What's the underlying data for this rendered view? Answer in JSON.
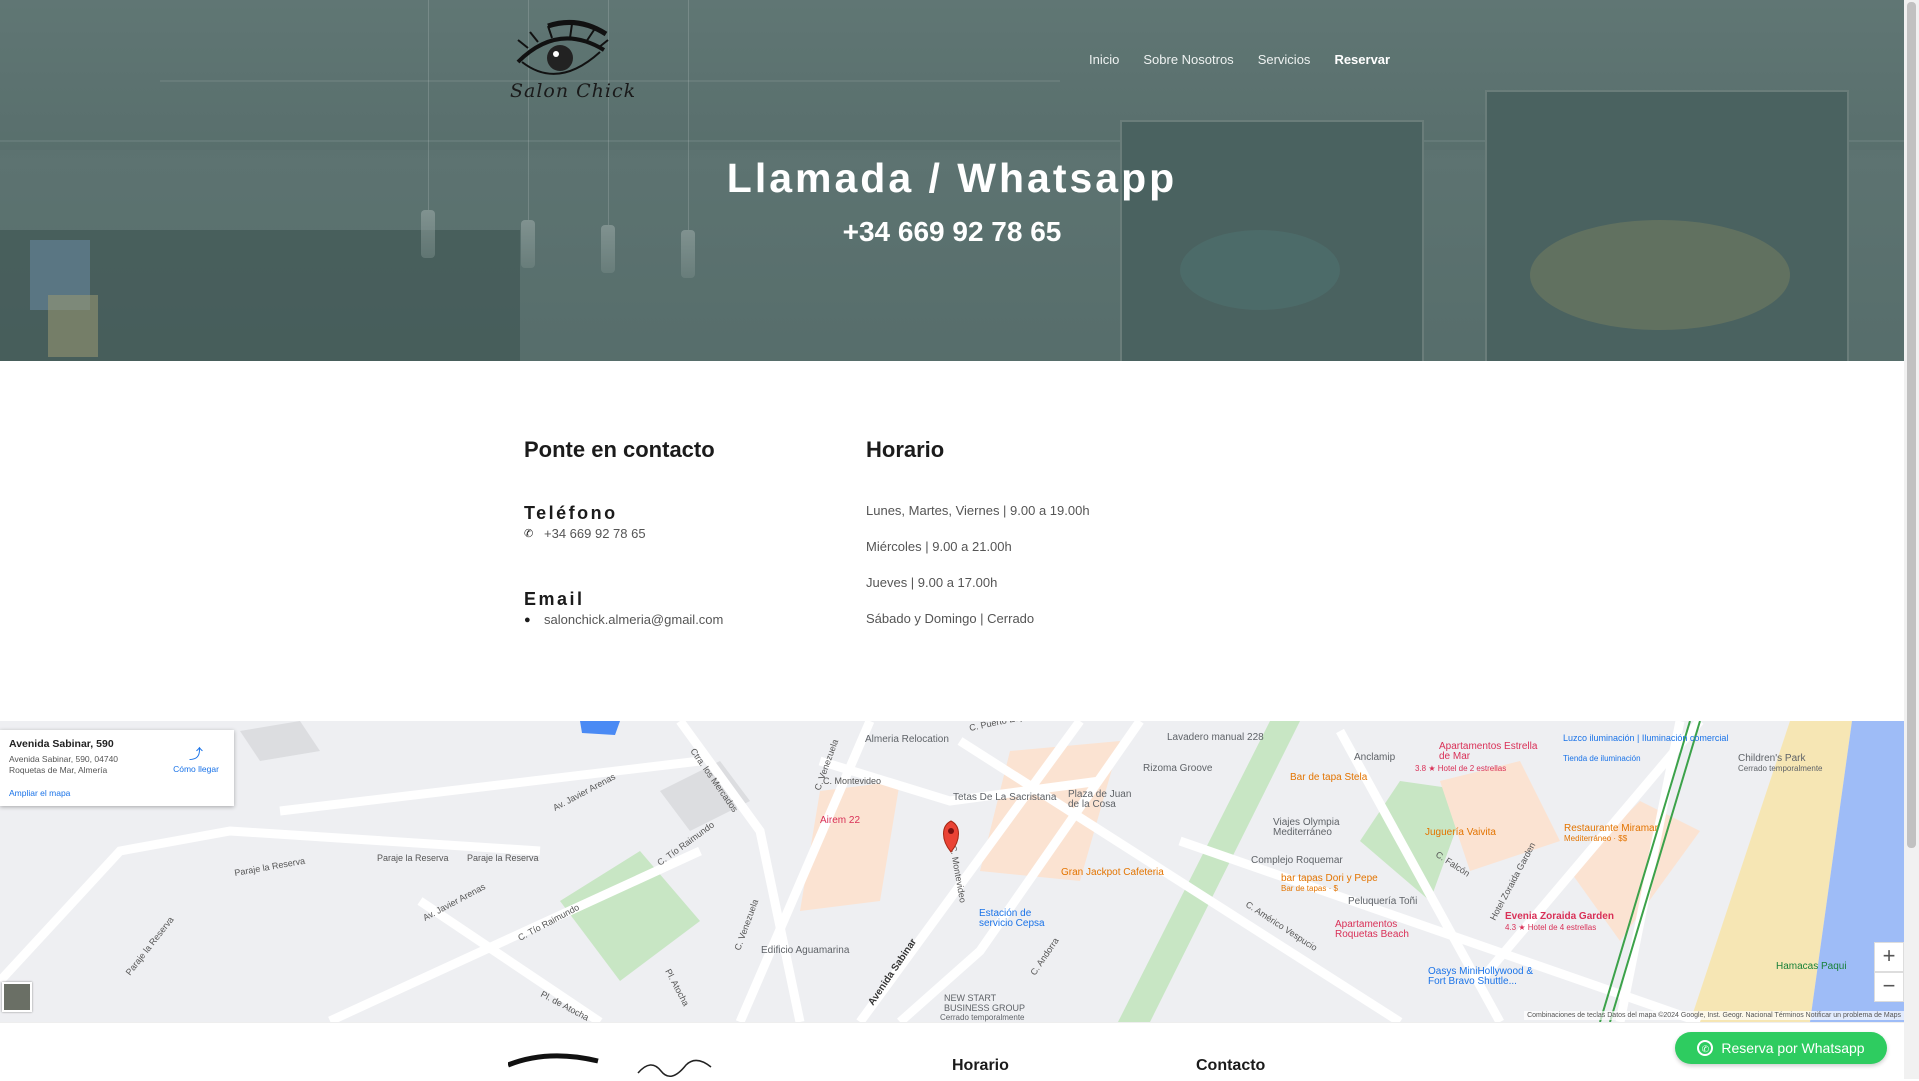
{
  "brand": {
    "logo_script": "Salon Chick"
  },
  "nav": {
    "items": [
      "Inicio",
      "Sobre Nosotros",
      "Servicios",
      "Reservar"
    ]
  },
  "hero": {
    "title": "Llamada / Whatsapp",
    "phone": "+34 669 92 78 65"
  },
  "contact": {
    "heading": "Ponte en contacto",
    "phone_label": "Teléfono",
    "phone_value": "+34 669 92 78 65",
    "email_label": "Email",
    "email_value": "salonchick.almeria@gmail.com"
  },
  "schedule": {
    "heading": "Horario",
    "lines": [
      "Lunes, Martes, Viernes | 9.00 a 19.00h",
      "Miércoles | 9.00 a 21.00h",
      "Jueves | 9.00 a 17.00h",
      "Sábado y Domingo | Cerrado"
    ]
  },
  "map": {
    "card_title": "Avenida Sabinar, 590",
    "card_address": "Avenida Sabinar, 590, 04740 Roquetas de Mar, Almería",
    "card_enlarge": "Ampliar el mapa",
    "card_directions": "Cómo llegar",
    "zoom_in": "+",
    "zoom_out": "−",
    "attribution": "Combinaciones de teclas   Datos del mapa ©2024 Google, Inst. Geogr. Nacional   Términos   Notificar un problema de Maps",
    "streets": [
      "Paraje la Reserva",
      "Paraje la Reserva",
      "Paraje la Reserva",
      "Paraje la Reserva",
      "Av. Javier Arenas",
      "Av. Javier Arenas",
      "C. Tío Raimundo",
      "C. Tío Raimundo",
      "Pl. de Atocha",
      "Pl. Atocha",
      "Ctra. los Mercados",
      "C. Venezuela",
      "C. Venezuela",
      "C. Montevideo",
      "C. Montevideo",
      "Avenida Sabinar",
      "C. Andorra",
      "C. Américo Vespucio",
      "C. Falcón",
      "Hotel Zoraida Garden",
      "C. Puerto España"
    ],
    "pois": [
      {
        "name": "Almeria Relocation",
        "color": "#5f6368"
      },
      {
        "name": "Lavadero manual 228",
        "color": "#5f6368"
      },
      {
        "name": "Rizoma Groove",
        "color": "#5f6368"
      },
      {
        "name": "Bar de tapa Stela",
        "color": "#e37400"
      },
      {
        "name": "Anclamip",
        "color": "#5f6368"
      },
      {
        "name": "Apartamentos Estrella de Mar",
        "color": "#d93057"
      },
      {
        "name": "3.8 ★ Hotel de 2 estrellas",
        "color": "#d93057"
      },
      {
        "name": "Luzco iluminación | Iluminación comercial",
        "color": "#1a73e8"
      },
      {
        "name": "Tienda de iluminación",
        "color": "#1a73e8"
      },
      {
        "name": "Children's Park",
        "color": "#5f6368"
      },
      {
        "name": "Cerrado temporalmente",
        "color": "#5f6368"
      },
      {
        "name": "Airem 22",
        "color": "#d93057"
      },
      {
        "name": "Tetas De La Sacristana",
        "color": "#5f6368"
      },
      {
        "name": "Plaza de Juan de la Cosa",
        "color": "#5f6368"
      },
      {
        "name": "Viajes Olympia Mediterráneo",
        "color": "#5f6368"
      },
      {
        "name": "Juguería Vaivita",
        "color": "#e37400"
      },
      {
        "name": "Restaurante Miramar",
        "color": "#e37400"
      },
      {
        "name": "Mediterráneo · $$",
        "color": "#e37400"
      },
      {
        "name": "Gran Jackpot Cafeteria",
        "color": "#e37400"
      },
      {
        "name": "Complejo Roquemar",
        "color": "#5f6368"
      },
      {
        "name": "bar tapas Dori y Pepe",
        "color": "#e37400"
      },
      {
        "name": "Bar de tapas · $",
        "color": "#e37400"
      },
      {
        "name": "Peluquería Toñi",
        "color": "#5f6368"
      },
      {
        "name": "Evenia Zoraida Garden",
        "color": "#d93057"
      },
      {
        "name": "4.3 ★ Hotel de 4 estrellas",
        "color": "#d93057"
      },
      {
        "name": "Estación de servicio Cepsa",
        "color": "#1a73e8"
      },
      {
        "name": "Apartamentos Roquetas Beach",
        "color": "#d93057"
      },
      {
        "name": "Edificio Aguamarina",
        "color": "#5f6368"
      },
      {
        "name": "Oasys MiniHollywood & Fort Bravo Shuttle...",
        "color": "#1a73e8"
      },
      {
        "name": "Hamacas Paqui",
        "color": "#188038"
      },
      {
        "name": "NEW START BUSINESS GROUP",
        "color": "#5f6368"
      },
      {
        "name": "Cerrado temporalmente",
        "color": "#5f6368"
      }
    ]
  },
  "footer": {
    "schedule_heading": "Horario",
    "contact_heading": "Contacto"
  },
  "whatsapp_button": {
    "label": "Reserva por Whatsapp"
  },
  "colors": {
    "accent_green": "#2ecc60",
    "hero_overlay": "#5f7674",
    "map_water": "#9ebcf7",
    "map_park": "#c8e6c4",
    "map_beach": "#f6e6b4"
  }
}
